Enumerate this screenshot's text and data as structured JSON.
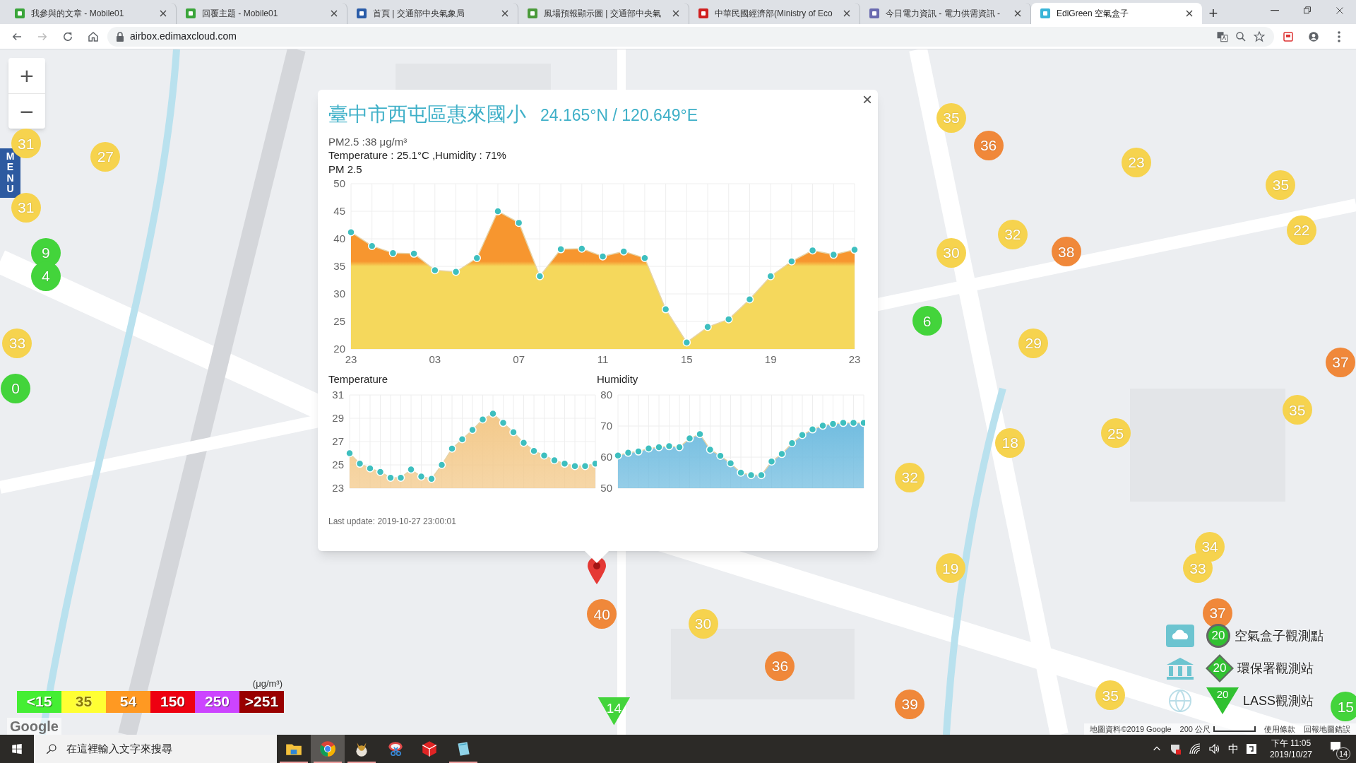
{
  "browser": {
    "tabs": [
      {
        "title": "我參與的文章 - Mobile01",
        "selected": false
      },
      {
        "title": "回覆主題 - Mobile01",
        "selected": false
      },
      {
        "title": "首頁 | 交通部中央氣象局",
        "selected": false
      },
      {
        "title": "風場預報顯示圖 | 交通部中央氣",
        "selected": false
      },
      {
        "title": "中華民國經濟部(Ministry of Eco",
        "selected": false
      },
      {
        "title": "今日電力資訊 - 電力供需資訊 -",
        "selected": false
      },
      {
        "title": "EdiGreen 空氣盒子",
        "selected": true
      }
    ],
    "new_tab": "+",
    "address": "airbox.edimaxcloud.com"
  },
  "map": {
    "zoom_in": "+",
    "zoom_out": "−",
    "menu": "MENU",
    "markers": [
      {
        "value": "31",
        "kind": "circle",
        "color": "#f6d34e"
      },
      {
        "value": "27",
        "kind": "circle",
        "color": "#f6d34e"
      },
      {
        "value": "35",
        "kind": "circle",
        "color": "#f6d34e"
      },
      {
        "value": "36",
        "kind": "circle",
        "color": "#f0883a"
      },
      {
        "value": "23",
        "kind": "circle",
        "color": "#f6d34e"
      },
      {
        "value": "35",
        "kind": "circle",
        "color": "#f6d34e"
      },
      {
        "value": "31",
        "kind": "circle",
        "color": "#f6d34e"
      },
      {
        "value": "9",
        "kind": "circle",
        "color": "#43d43b"
      },
      {
        "value": "30",
        "kind": "circle",
        "color": "#f6d34e"
      },
      {
        "value": "32",
        "kind": "circle",
        "color": "#f6d34e"
      },
      {
        "value": "38",
        "kind": "circle",
        "color": "#f0883a"
      },
      {
        "value": "22",
        "kind": "circle",
        "color": "#f6d34e"
      },
      {
        "value": "4",
        "kind": "circle",
        "color": "#43d43b"
      },
      {
        "value": "6",
        "kind": "circle",
        "color": "#43d43b"
      },
      {
        "value": "33",
        "kind": "circle",
        "color": "#f6d34e"
      },
      {
        "value": "29",
        "kind": "circle",
        "color": "#f6d34e"
      },
      {
        "value": "37",
        "kind": "circle",
        "color": "#f0883a"
      },
      {
        "value": "0",
        "kind": "circle",
        "color": "#43d43b"
      },
      {
        "value": "18",
        "kind": "circle",
        "color": "#f6d34e"
      },
      {
        "value": "25",
        "kind": "circle",
        "color": "#f6d34e"
      },
      {
        "value": "35",
        "kind": "circle",
        "color": "#f6d34e"
      },
      {
        "value": "32",
        "kind": "circle",
        "color": "#f6d34e"
      },
      {
        "value": "34",
        "kind": "circle",
        "color": "#f6d34e"
      },
      {
        "value": "19",
        "kind": "circle",
        "color": "#f6d34e"
      },
      {
        "value": "33",
        "kind": "circle",
        "color": "#f6d34e"
      },
      {
        "value": "40",
        "kind": "circle",
        "color": "#f0883a"
      },
      {
        "value": "30",
        "kind": "circle",
        "color": "#f6d34e"
      },
      {
        "value": "37",
        "kind": "circle",
        "color": "#f0883a"
      },
      {
        "value": "36",
        "kind": "circle",
        "color": "#f0883a"
      },
      {
        "value": "14",
        "kind": "triangle",
        "color": "#43d43b"
      },
      {
        "value": "39",
        "kind": "circle",
        "color": "#f0883a"
      },
      {
        "value": "35",
        "kind": "circle",
        "color": "#f6d34e"
      },
      {
        "value": "15",
        "kind": "circle",
        "color": "#43d43b"
      }
    ],
    "popup": {
      "title": "臺中市西屯區惠來國小",
      "coords": "24.165°N / 120.649°E",
      "close": "×",
      "pm_reading": "PM2.5 :38 μg/m³",
      "weather": "Temperature : 25.1°C ,Humidity : 71%",
      "pm_chart": {
        "x_labels": [
          "23",
          "03",
          "07",
          "11",
          "15",
          "19",
          "23"
        ],
        "chart_data": {
          "type": "area",
          "title": "PM 2.5",
          "grid": true,
          "ylim": [
            20,
            50
          ],
          "yticks": [
            20,
            25,
            30,
            35,
            40,
            45,
            50
          ],
          "series": [
            {
              "color": "#f5d85c",
              "values": [
                41.2,
                38.7,
                37.4,
                37.3,
                34.3,
                34.0,
                36.5,
                45.0,
                42.9,
                33.2,
                38.1,
                38.2,
                36.8,
                37.7,
                36.5,
                27.2,
                21.2,
                24.0,
                25.4,
                29.0,
                33.2,
                35.9,
                37.9,
                37.1,
                38.0
              ]
            }
          ]
        }
      },
      "temperature": {
        "chart_data": {
          "type": "area",
          "title": "Temperature",
          "grid": true,
          "ylim": [
            23,
            31
          ],
          "yticks": [
            23,
            25,
            27,
            29,
            31
          ],
          "series": [
            {
              "color": "#f3c98a",
              "values": [
                26.0,
                25.1,
                24.7,
                24.4,
                23.9,
                23.9,
                24.6,
                24.0,
                23.8,
                25.0,
                26.4,
                27.2,
                28.0,
                28.9,
                29.4,
                28.6,
                27.8,
                26.9,
                26.2,
                25.8,
                25.4,
                25.1,
                24.9,
                24.9,
                25.1
              ]
            }
          ]
        }
      },
      "humidity": {
        "chart_data": {
          "type": "area",
          "title": "Humidity",
          "grid": true,
          "ylim": [
            50,
            80
          ],
          "yticks": [
            50,
            60,
            70,
            80
          ],
          "series": [
            {
              "color": "#72bde0",
              "values": [
                60.5,
                61.4,
                61.8,
                62.8,
                63.2,
                63.5,
                63.2,
                66.0,
                67.4,
                62.4,
                60.4,
                58.0,
                55.0,
                54.2,
                54.2,
                58.6,
                61.0,
                64.5,
                67.1,
                68.9,
                70.1,
                70.7,
                71.0,
                71.0,
                71.0
              ]
            }
          ]
        }
      },
      "last_update": "Last update: 2019-10-27 23:00:01"
    },
    "pm_scale": {
      "unit": "(μg/m³)",
      "levels": [
        {
          "label": "<15",
          "color": "#44ee33"
        },
        {
          "label": "35",
          "color": "#ffff33"
        },
        {
          "label": "54",
          "color": "#ff9922"
        },
        {
          "label": "150",
          "color": "#ee0011"
        },
        {
          "label": "250",
          "color": "#cc44ff"
        },
        {
          "label": ">251",
          "color": "#990000"
        }
      ]
    },
    "legend": [
      {
        "kind": "circle",
        "sample": "20",
        "label": "空氣盒子觀測點"
      },
      {
        "kind": "diamond",
        "sample": "20",
        "label": "環保署觀測站"
      },
      {
        "kind": "triangle",
        "sample": "20",
        "label": "LASS觀測站"
      }
    ],
    "footer": {
      "logo": "Google",
      "attribution": "地圖資料©2019 Google",
      "scale": "200 公尺",
      "terms": "使用條款",
      "report": "回報地圖錯誤"
    }
  },
  "taskbar": {
    "search_placeholder": "在這裡輸入文字來搜尋",
    "apps": [
      {
        "kind": "folder",
        "selected": false,
        "running": true
      },
      {
        "kind": "chrome",
        "selected": true,
        "running": true
      },
      {
        "kind": "egg",
        "selected": false,
        "running": true
      },
      {
        "kind": "scissors",
        "selected": false,
        "running": false
      },
      {
        "kind": "cube",
        "selected": false,
        "running": false
      },
      {
        "kind": "notepad",
        "selected": false,
        "running": true
      }
    ],
    "ime": "中",
    "time": "下午 11:05",
    "date": "2019/10/27",
    "notifications": "14"
  }
}
